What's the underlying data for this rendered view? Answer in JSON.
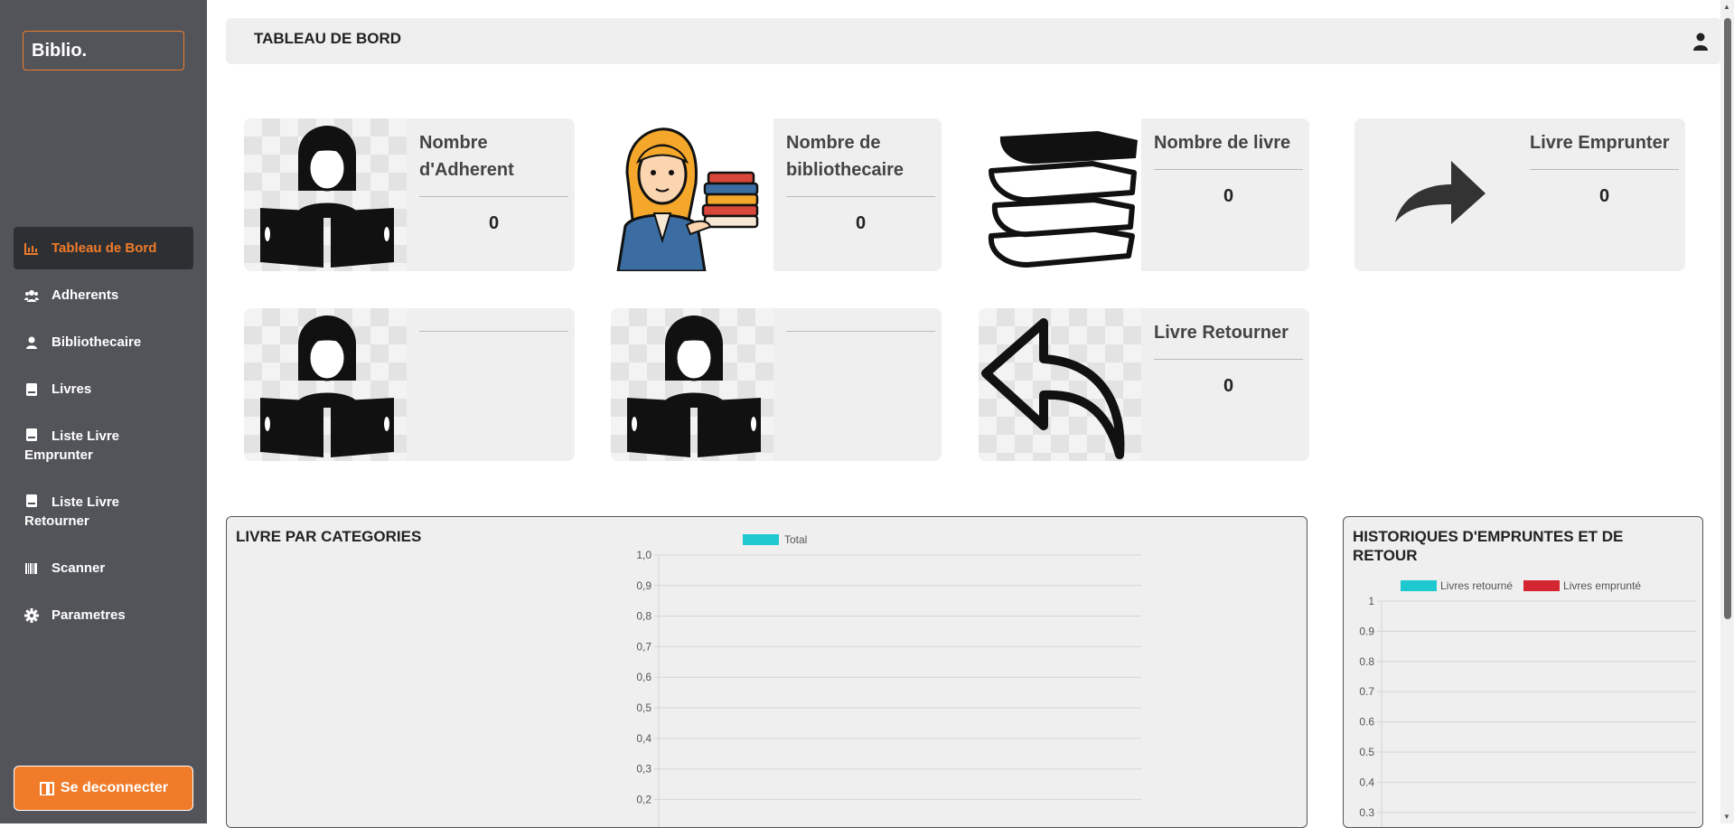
{
  "brand": "Biblio.",
  "sidebar": {
    "items": [
      {
        "label": "Tableau de Bord",
        "icon": "chart-icon"
      },
      {
        "label": "Adherents",
        "icon": "users-icon"
      },
      {
        "label": "Bibliothecaire",
        "icon": "user-icon"
      },
      {
        "label": "Livres",
        "icon": "book-icon"
      },
      {
        "label": "Liste Livre Emprunter",
        "icon": "book-icon"
      },
      {
        "label": "Liste Livre Retourner",
        "icon": "book-icon"
      },
      {
        "label": "Scanner",
        "icon": "barcode-icon"
      },
      {
        "label": "Parametres",
        "icon": "gear-icon"
      }
    ],
    "logout_label": "Se deconnecter"
  },
  "header": {
    "title": "TABLEAU DE BORD"
  },
  "cards": [
    {
      "title": "Nombre d'Adherent",
      "value": "0"
    },
    {
      "title": "Nombre de bibliothecaire",
      "value": "0"
    },
    {
      "title": "Nombre de livre",
      "value": "0"
    },
    {
      "title": "Livre Emprunter",
      "value": "0"
    },
    {
      "title": "",
      "value": ""
    },
    {
      "title": "",
      "value": ""
    },
    {
      "title": "Livre Retourner",
      "value": "0"
    }
  ],
  "chart_data": [
    {
      "type": "bar",
      "title": "LIVRE PAR CATEGORIES",
      "series": [
        {
          "name": "Total",
          "values": [],
          "color": "#1ec8cf"
        }
      ],
      "categories": [],
      "ylim": [
        0,
        1
      ],
      "yticks": [
        "1,0",
        "0,9",
        "0,8",
        "0,7",
        "0,6",
        "0,5",
        "0,4",
        "0,3",
        "0,2"
      ],
      "grid": true,
      "legend": "top"
    },
    {
      "type": "bar",
      "title": "HISTORIQUES D'EMPRUNTES ET DE RETOUR",
      "series": [
        {
          "name": "Livres retourné",
          "values": [],
          "color": "#1ec8cf"
        },
        {
          "name": "Livres emprunté",
          "values": [],
          "color": "#d32630"
        }
      ],
      "categories": [],
      "ylim": [
        0,
        1
      ],
      "yticks": [
        "1",
        "0.9",
        "0.8",
        "0.7",
        "0.6",
        "0.5",
        "0.4",
        "0.3"
      ],
      "grid": true,
      "legend": "top"
    }
  ]
}
